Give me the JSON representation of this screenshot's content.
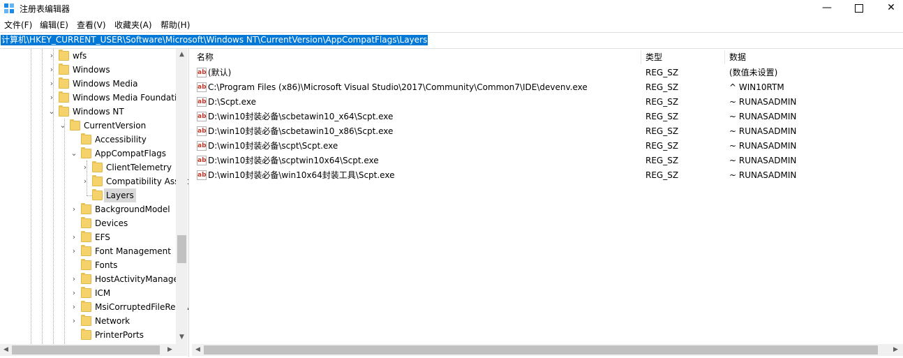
{
  "window": {
    "title": "注册表编辑器",
    "minimize_label": "—",
    "close_label": "✕"
  },
  "menu": {
    "items": [
      "文件(F)",
      "编辑(E)",
      "查看(V)",
      "收藏夹(A)",
      "帮助(H)"
    ]
  },
  "address": {
    "path": "计算机\\HKEY_CURRENT_USER\\Software\\Microsoft\\Windows NT\\CurrentVersion\\AppCompatFlags\\Layers"
  },
  "tree": {
    "items": [
      {
        "label": "wfs",
        "expander": "collapsed",
        "selected": false
      },
      {
        "label": "Windows",
        "expander": "collapsed",
        "selected": false
      },
      {
        "label": "Windows Media",
        "expander": "collapsed",
        "selected": false
      },
      {
        "label": "Windows Media Foundation",
        "expander": "collapsed",
        "selected": false
      },
      {
        "label": "Windows NT",
        "expander": "expanded",
        "selected": false
      },
      {
        "label": "CurrentVersion",
        "expander": "expanded",
        "selected": false
      },
      {
        "label": "Accessibility",
        "expander": "none",
        "selected": false
      },
      {
        "label": "AppCompatFlags",
        "expander": "expanded",
        "selected": false
      },
      {
        "label": "ClientTelemetry",
        "expander": "collapsed",
        "selected": false
      },
      {
        "label": "Compatibility Assistant",
        "expander": "collapsed",
        "selected": false
      },
      {
        "label": "Layers",
        "expander": "none",
        "selected": true
      },
      {
        "label": "BackgroundModel",
        "expander": "collapsed",
        "selected": false
      },
      {
        "label": "Devices",
        "expander": "none",
        "selected": false
      },
      {
        "label": "EFS",
        "expander": "collapsed",
        "selected": false
      },
      {
        "label": "Font Management",
        "expander": "collapsed",
        "selected": false
      },
      {
        "label": "Fonts",
        "expander": "none",
        "selected": false
      },
      {
        "label": "HostActivityManager",
        "expander": "collapsed",
        "selected": false
      },
      {
        "label": "ICM",
        "expander": "collapsed",
        "selected": false
      },
      {
        "label": "MsiCorruptedFileRecovery",
        "expander": "collapsed",
        "selected": false
      },
      {
        "label": "Network",
        "expander": "collapsed",
        "selected": false
      },
      {
        "label": "PrinterPorts",
        "expander": "none",
        "selected": false
      }
    ]
  },
  "list": {
    "headers": {
      "name": "名称",
      "type": "类型",
      "data": "数据"
    },
    "rows": [
      {
        "name": "(默认)",
        "type": "REG_SZ",
        "data": "(数值未设置)"
      },
      {
        "name": "C:\\Program Files (x86)\\Microsoft Visual Studio\\2017\\Community\\Common7\\IDE\\devenv.exe",
        "type": "REG_SZ",
        "data": "^ WIN10RTM"
      },
      {
        "name": "D:\\Scpt.exe",
        "type": "REG_SZ",
        "data": "~ RUNASADMIN"
      },
      {
        "name": "D:\\win10封装必备\\scbetawin10_x64\\Scpt.exe",
        "type": "REG_SZ",
        "data": "~ RUNASADMIN"
      },
      {
        "name": "D:\\win10封装必备\\scbetawin10_x86\\Scpt.exe",
        "type": "REG_SZ",
        "data": "~ RUNASADMIN"
      },
      {
        "name": "D:\\win10封装必备\\scpt\\Scpt.exe",
        "type": "REG_SZ",
        "data": "~ RUNASADMIN"
      },
      {
        "name": "D:\\win10封装必备\\scptwin10x64\\Scpt.exe",
        "type": "REG_SZ",
        "data": "~ RUNASADMIN"
      },
      {
        "name": "D:\\win10封装必备\\win10x64封装工具\\Scpt.exe",
        "type": "REG_SZ",
        "data": "~ RUNASADMIN"
      }
    ]
  },
  "colors": {
    "selection": "#0078d7",
    "folder": "#f6d36a",
    "tree_selected": "#d9d9d9"
  }
}
